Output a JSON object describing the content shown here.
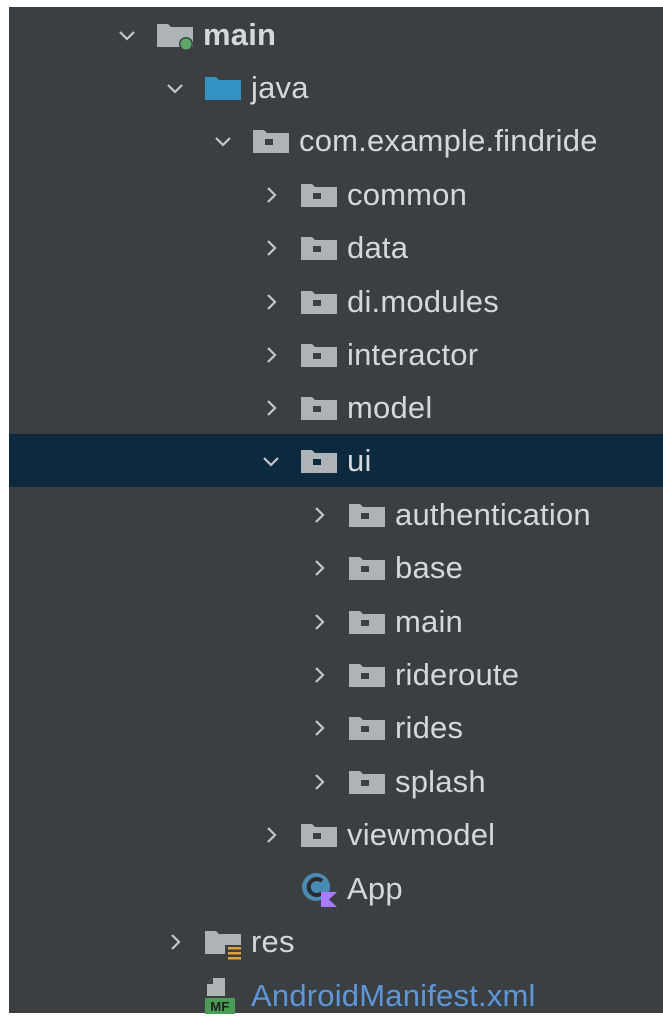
{
  "tree": {
    "rows": [
      {
        "label": "main",
        "state": "expanded",
        "icon": "source-root-folder-icon",
        "depth": 0
      },
      {
        "label": "java",
        "state": "expanded",
        "icon": "java-source-folder-icon",
        "depth": 1
      },
      {
        "label": "com.example.findride",
        "state": "expanded",
        "icon": "package-icon",
        "depth": 2
      },
      {
        "label": "common",
        "state": "collapsed",
        "icon": "package-icon",
        "depth": 3
      },
      {
        "label": "data",
        "state": "collapsed",
        "icon": "package-icon",
        "depth": 3
      },
      {
        "label": "di.modules",
        "state": "collapsed",
        "icon": "package-icon",
        "depth": 3
      },
      {
        "label": "interactor",
        "state": "collapsed",
        "icon": "package-icon",
        "depth": 3
      },
      {
        "label": "model",
        "state": "collapsed",
        "icon": "package-icon",
        "depth": 3
      },
      {
        "label": "ui",
        "state": "expanded",
        "icon": "package-icon",
        "depth": 3,
        "selected": true
      },
      {
        "label": "authentication",
        "state": "collapsed",
        "icon": "package-icon",
        "depth": 4
      },
      {
        "label": "base",
        "state": "collapsed",
        "icon": "package-icon",
        "depth": 4
      },
      {
        "label": "main",
        "state": "collapsed",
        "icon": "package-icon",
        "depth": 4
      },
      {
        "label": "rideroute",
        "state": "collapsed",
        "icon": "package-icon",
        "depth": 4
      },
      {
        "label": "rides",
        "state": "collapsed",
        "icon": "package-icon",
        "depth": 4
      },
      {
        "label": "splash",
        "state": "collapsed",
        "icon": "package-icon",
        "depth": 4
      },
      {
        "label": "viewmodel",
        "state": "collapsed",
        "icon": "package-icon",
        "depth": 3
      },
      {
        "label": "App",
        "state": "leaf",
        "icon": "kotlin-class-icon",
        "depth": 3
      },
      {
        "label": "res",
        "state": "collapsed",
        "icon": "resources-folder-icon",
        "depth": 1
      },
      {
        "label": "AndroidManifest.xml",
        "state": "leaf",
        "icon": "android-manifest-icon",
        "depth": 1
      }
    ]
  },
  "colors": {
    "background": "#3c3f41",
    "selection": "#0d293e",
    "text": "#d5d8db",
    "manifest_text": "#5d97d9",
    "folder_gray": "#aeb3b8",
    "java_folder_blue": "#3592c4",
    "source_root_dot": "#59a869",
    "kotlin_purple": "#a97bff",
    "resources_bars": "#e0a33a",
    "manifest_green": "#499c54"
  }
}
